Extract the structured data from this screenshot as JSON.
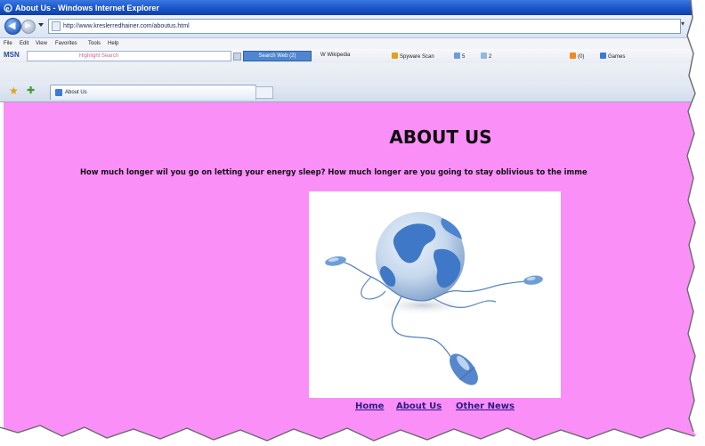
{
  "window": {
    "title": "About Us - Windows Internet Explorer"
  },
  "address_bar": {
    "url": "http://www.kreslerredhainer.com/aboutus.html"
  },
  "menu": [
    "File",
    "Edit",
    "View",
    "Favorites",
    "Tools",
    "Help"
  ],
  "msn_toolbar": {
    "logo": "MSN",
    "search_text": "Highlight  Search",
    "search_button": "Search Web (2)",
    "items": [
      "W Wikipedia",
      "Spyware Scan",
      "5",
      "2",
      "(0)",
      "Games"
    ]
  },
  "tabs": [
    {
      "label": "About Us"
    }
  ],
  "page": {
    "heading": "ABOUT US",
    "intro": "How much longer wil you go on letting your energy sleep?  How much longer are you going to stay oblivious to the imme",
    "nav": [
      {
        "label": "Home"
      },
      {
        "label": "About Us"
      },
      {
        "label": "Other News"
      }
    ]
  },
  "colors": {
    "page_background": "#fa8ff8",
    "link": "#2a1b86",
    "title_bar": "#1a54c8"
  }
}
